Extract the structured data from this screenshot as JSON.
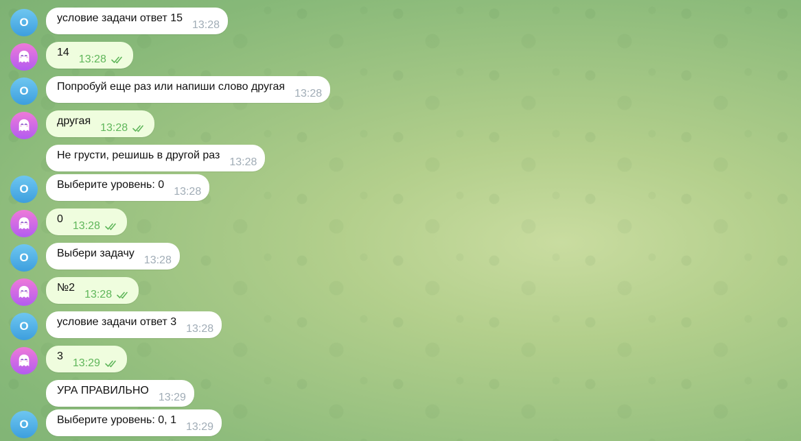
{
  "chat": {
    "messages": [
      {
        "sender": "bot",
        "avatar_letter": "O",
        "text": "условие задачи ответ 15",
        "time": "13:28",
        "show_avatar": true
      },
      {
        "sender": "user",
        "avatar_letter": "",
        "text": "14",
        "time": "13:28",
        "show_avatar": true
      },
      {
        "sender": "bot",
        "avatar_letter": "O",
        "text": "Попробуй еще раз или напиши слово другая",
        "time": "13:28",
        "show_avatar": true
      },
      {
        "sender": "user",
        "avatar_letter": "",
        "text": "другая",
        "time": "13:28",
        "show_avatar": true
      },
      {
        "sender": "bot",
        "avatar_letter": "O",
        "text": "Не грусти, решишь в другой раз",
        "time": "13:28",
        "show_avatar": false
      },
      {
        "sender": "bot",
        "avatar_letter": "O",
        "text": "Выберите уровень: 0",
        "time": "13:28",
        "show_avatar": true
      },
      {
        "sender": "user",
        "avatar_letter": "",
        "text": "0",
        "time": "13:28",
        "show_avatar": true
      },
      {
        "sender": "bot",
        "avatar_letter": "O",
        "text": "Выбери задачу",
        "time": "13:28",
        "show_avatar": true
      },
      {
        "sender": "user",
        "avatar_letter": "",
        "text": "№2",
        "time": "13:28",
        "show_avatar": true
      },
      {
        "sender": "bot",
        "avatar_letter": "O",
        "text": "условие задачи ответ 3",
        "time": "13:28",
        "show_avatar": true
      },
      {
        "sender": "user",
        "avatar_letter": "",
        "text": "3",
        "time": "13:29",
        "show_avatar": true
      },
      {
        "sender": "bot",
        "avatar_letter": "O",
        "text": "УРА ПРАВИЛЬНО",
        "time": "13:29",
        "show_avatar": false
      },
      {
        "sender": "bot",
        "avatar_letter": "O",
        "text": "Выберите уровень: 0, 1",
        "time": "13:29",
        "show_avatar": true
      }
    ]
  },
  "colors": {
    "incoming_bubble": "#ffffff",
    "outgoing_bubble": "#effdde",
    "outgoing_time": "#5fb65a",
    "incoming_time": "#a0acb6",
    "bot_avatar": "#3d9fde",
    "user_avatar": "#b35cf0"
  },
  "icons": {
    "read_receipt": "double-check-icon",
    "user_avatar": "ghost-icon"
  }
}
